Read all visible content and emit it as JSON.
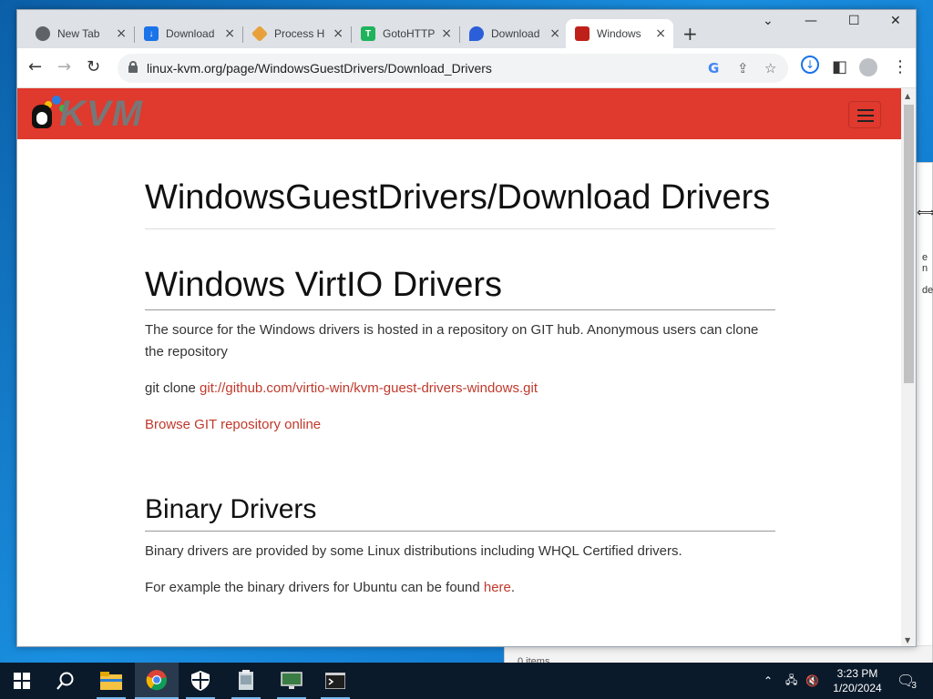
{
  "tabs": [
    {
      "title": "New Tab",
      "favicon": "chrome-icon"
    },
    {
      "title": "Download",
      "favicon": "download-icon"
    },
    {
      "title": "Process H",
      "favicon": "process-hacker-icon"
    },
    {
      "title": "GotoHTTP",
      "favicon": "gotohttp-icon"
    },
    {
      "title": "Download",
      "favicon": "download-page-icon"
    },
    {
      "title": "Windows",
      "favicon": "kvm-icon"
    }
  ],
  "address": {
    "url": "linux-kvm.org/page/WindowsGuestDrivers/Download_Drivers"
  },
  "site": {
    "logo_text": "KVM",
    "header_color": "#e0392d"
  },
  "article": {
    "title": "WindowsGuestDrivers/Download Drivers",
    "section1": {
      "heading": "Windows VirtIO Drivers",
      "para1": "The source for the Windows drivers is hosted in a repository on GIT hub. Anonymous users can clone the repository",
      "clone_prefix": "git clone ",
      "clone_link": "git://github.com/virtio-win/kvm-guest-drivers-windows.git",
      "browse_link": "Browse GIT repository online"
    },
    "section2": {
      "heading": "Binary Drivers",
      "para1": "Binary drivers are provided by some Linux distributions including WHQL Certified drivers.",
      "para2_prefix": "For example the binary drivers for Ubuntu can be found ",
      "para2_link": "here",
      "para2_suffix": "."
    }
  },
  "background_window": {
    "stub1": "e n",
    "stub2": "de",
    "status": "0 items"
  },
  "taskbar": {
    "time": "3:23 PM",
    "date": "1/20/2024",
    "notification_count": "3"
  }
}
